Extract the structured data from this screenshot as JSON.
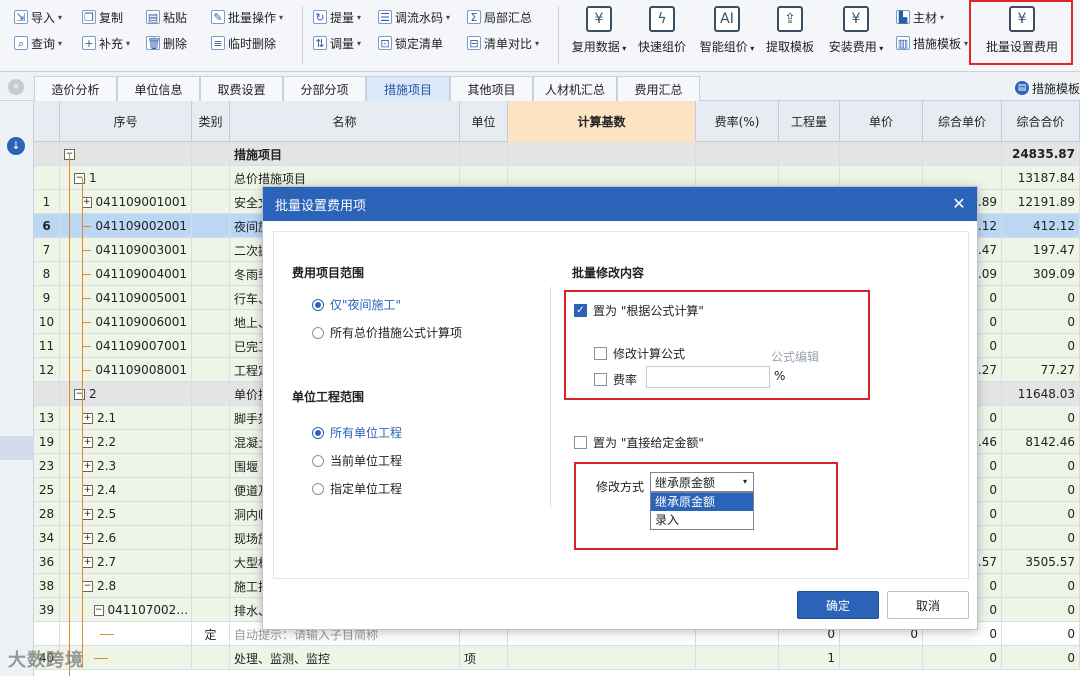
{
  "toolbar": {
    "import": "导入",
    "copy": "复制",
    "paste": "粘贴",
    "batch_op": "批量操作",
    "query": "查询",
    "supplement": "补充",
    "delete": "删除",
    "temp_delete": "临时删除",
    "quantity_up": "提量",
    "serial_adjust": "调流水码",
    "local_summary": "局部汇总",
    "quantity_adjust": "调量",
    "lock_list": "锁定清单",
    "list_compare": "清单对比",
    "main_material": "主材",
    "reuse_data": "复用数据",
    "quick_price": "快速组价",
    "smart_price": "智能组价",
    "extract_template": "提取模板",
    "install_fee": "安装费用",
    "measure_template": "措施模板",
    "batch_set_fee": "批量设置费用"
  },
  "tabs": [
    "造价分析",
    "单位信息",
    "取费设置",
    "分部分项",
    "措施项目",
    "其他项目",
    "人材机汇总",
    "费用汇总"
  ],
  "active_tab": "措施项目",
  "template_link": "措施模板",
  "columns": [
    "序号",
    "类别",
    "名称",
    "单位",
    "计算基数",
    "费率(%)",
    "工程量",
    "单价",
    "综合单价",
    "综合合价"
  ],
  "rows": [
    {
      "idx": "",
      "seq": "措施项目",
      "cat": "",
      "name": "措施项目",
      "unit": "",
      "qty": "",
      "up": "",
      "cup": "",
      "total": "24835.87",
      "kind": "group",
      "tree": "minus",
      "lvl": 0
    },
    {
      "idx": "",
      "seq": "1",
      "cat": "",
      "name": "总价措施项目",
      "unit": "",
      "qty": "",
      "up": "",
      "cup": "",
      "total": "13187.84",
      "kind": "sub",
      "tree": "minus",
      "lvl": 1
    },
    {
      "idx": "1",
      "seq": "041109001001",
      "cat": "",
      "name": "安全文",
      "unit": "",
      "qty": "",
      "up": "",
      "cup": ".89",
      "total": "12191.89",
      "kind": "sub",
      "tree": "plus",
      "lvl": 2
    },
    {
      "idx": "6",
      "seq": "041109002001",
      "cat": "",
      "name": "夜间施",
      "unit": "",
      "qty": "",
      "up": "",
      "cup": ".12",
      "total": "412.12",
      "kind": "sel",
      "tree": "",
      "lvl": 2
    },
    {
      "idx": "7",
      "seq": "041109003001",
      "cat": "",
      "name": "二次搬",
      "unit": "",
      "qty": "",
      "up": "",
      "cup": ".47",
      "total": "197.47",
      "kind": "sub",
      "tree": "",
      "lvl": 2
    },
    {
      "idx": "8",
      "seq": "041109004001",
      "cat": "",
      "name": "冬雨季",
      "unit": "",
      "qty": "",
      "up": "",
      "cup": ".09",
      "total": "309.09",
      "kind": "sub",
      "tree": "",
      "lvl": 2
    },
    {
      "idx": "9",
      "seq": "041109005001",
      "cat": "",
      "name": "行车、",
      "unit": "",
      "qty": "",
      "up": "",
      "cup": "0",
      "total": "0",
      "kind": "sub",
      "tree": "",
      "lvl": 2
    },
    {
      "idx": "10",
      "seq": "041109006001",
      "cat": "",
      "name": "地上、",
      "unit": "",
      "qty": "",
      "up": "",
      "cup": "0",
      "total": "0",
      "kind": "sub",
      "tree": "",
      "lvl": 2
    },
    {
      "idx": "11",
      "seq": "041109007001",
      "cat": "",
      "name": "已完工",
      "unit": "",
      "qty": "",
      "up": "",
      "cup": "0",
      "total": "0",
      "kind": "sub",
      "tree": "",
      "lvl": 2
    },
    {
      "idx": "12",
      "seq": "041109008001",
      "cat": "",
      "name": "工程定",
      "unit": "",
      "qty": "",
      "up": "",
      "cup": ".27",
      "total": "77.27",
      "kind": "sub",
      "tree": "",
      "lvl": 2
    },
    {
      "idx": "",
      "seq": "2",
      "cat": "",
      "name": "单价措",
      "unit": "",
      "qty": "",
      "up": "",
      "cup": "",
      "total": "11648.03",
      "kind": "group2",
      "tree": "minus",
      "lvl": 1
    },
    {
      "idx": "13",
      "seq": "2.1",
      "cat": "",
      "name": "脚手架",
      "unit": "",
      "qty": "",
      "up": "",
      "cup": "0",
      "total": "0",
      "kind": "sub",
      "tree": "plus",
      "lvl": 2
    },
    {
      "idx": "19",
      "seq": "2.2",
      "cat": "",
      "name": "混凝土",
      "unit": "",
      "qty": "",
      "up": "",
      "cup": ".46",
      "total": "8142.46",
      "kind": "sub",
      "tree": "plus",
      "lvl": 2
    },
    {
      "idx": "23",
      "seq": "2.3",
      "cat": "",
      "name": "围堰",
      "unit": "",
      "qty": "",
      "up": "",
      "cup": "0",
      "total": "0",
      "kind": "sub",
      "tree": "plus",
      "lvl": 2
    },
    {
      "idx": "25",
      "seq": "2.4",
      "cat": "",
      "name": "便道及",
      "unit": "",
      "qty": "",
      "up": "",
      "cup": "0",
      "total": "0",
      "kind": "sub",
      "tree": "plus",
      "lvl": 2
    },
    {
      "idx": "28",
      "seq": "2.5",
      "cat": "",
      "name": "洞内临",
      "unit": "",
      "qty": "",
      "up": "",
      "cup": "0",
      "total": "0",
      "kind": "sub",
      "tree": "plus",
      "lvl": 2
    },
    {
      "idx": "34",
      "seq": "2.6",
      "cat": "",
      "name": "现场施",
      "unit": "",
      "qty": "",
      "up": "",
      "cup": "0",
      "total": "0",
      "kind": "sub",
      "tree": "plus",
      "lvl": 2
    },
    {
      "idx": "36",
      "seq": "2.7",
      "cat": "",
      "name": "大型机",
      "unit": "",
      "qty": "",
      "up": "",
      "cup": ".57",
      "total": "3505.57",
      "kind": "sub",
      "tree": "plus",
      "lvl": 2
    },
    {
      "idx": "38",
      "seq": "2.8",
      "cat": "",
      "name": "施工排",
      "unit": "",
      "qty": "",
      "up": "",
      "cup": "0",
      "total": "0",
      "kind": "sub",
      "tree": "minus",
      "lvl": 2
    },
    {
      "idx": "39",
      "seq": "041107002…",
      "cat": "",
      "name": "排水、",
      "unit": "",
      "qty": "",
      "up": "",
      "cup": "0",
      "total": "0",
      "kind": "row39",
      "tree": "minus",
      "lvl": 3
    },
    {
      "idx": "",
      "seq": "",
      "cat": "定",
      "name": "自动提示：请输入子目简称",
      "unit": "",
      "qty": "0",
      "up": "0",
      "cup": "0",
      "total": "0",
      "kind": "alt",
      "tree": "",
      "lvl": 4
    },
    {
      "idx": "40",
      "seq": "",
      "cat": "",
      "name": "处理、监测、监控",
      "unit": "项",
      "qty": "1",
      "up": "",
      "cup": "0",
      "total": "0",
      "kind": "sub",
      "tree": "",
      "lvl": 3
    }
  ],
  "dialog": {
    "title": "批量设置费用项",
    "scope_title": "费用项目范围",
    "scope_opt1": "仅\"夜间施工\"",
    "scope_opt2": "所有总价措施公式计算项",
    "unit_title": "单位工程范围",
    "unit_opt1": "所有单位工程",
    "unit_opt2": "当前单位工程",
    "unit_opt3": "指定单位工程",
    "batch_title": "批量修改内容",
    "set_formula": "置为 \"根据公式计算\"",
    "modify_formula": "修改计算公式",
    "formula_edit": "公式编辑",
    "rate": "费率",
    "rate_value": "",
    "pct": "%",
    "set_fixed": "置为 \"直接给定金额\"",
    "mode_label": "修改方式",
    "mode_selected": "继承原金额",
    "mode_options": [
      "继承原金额",
      "录入"
    ],
    "ok": "确定",
    "cancel": "取消"
  },
  "watermark": "大数跨境"
}
